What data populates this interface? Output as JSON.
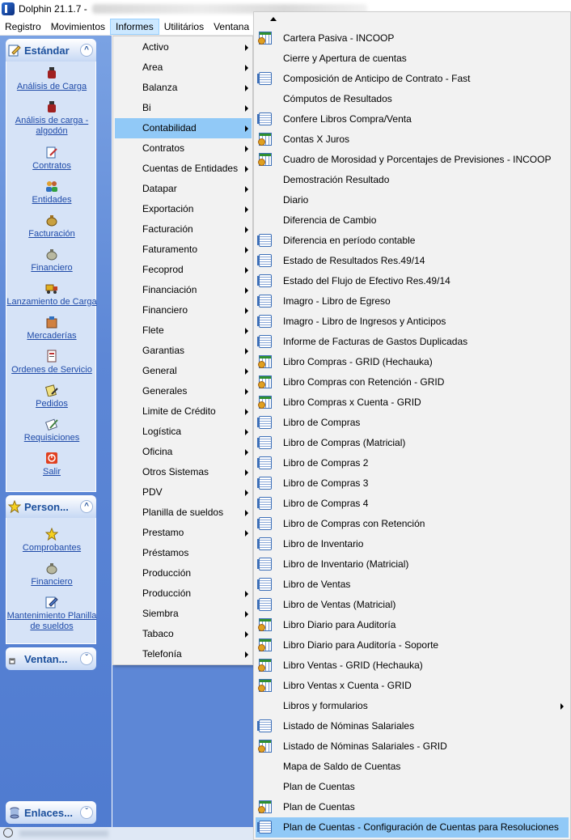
{
  "window": {
    "app_title": "Dolphin 21.1.7 -"
  },
  "menubar": [
    "Registro",
    "Movimientos",
    "Informes",
    "Utilitários",
    "Ventana"
  ],
  "left_panel": {
    "groups": [
      {
        "title": "Estándar",
        "items": [
          "Análisis de Carga",
          "Análisis de carga - algodón",
          "Contratos",
          "Entidades",
          "Facturación",
          "Financiero",
          "Lanzamiento de Carga",
          "Mercaderías",
          "Ordenes de Servicio",
          "Pedidos",
          "Requisiciones",
          "Salir"
        ]
      },
      {
        "title": "Person...",
        "items": [
          "Comprobantes",
          "Financiero",
          "Mantenimiento Planilla de sueldos"
        ]
      },
      {
        "title": "Ventan..."
      },
      {
        "title": "Enlaces..."
      }
    ]
  },
  "informes_menu": [
    "Activo",
    "Area",
    "Balanza",
    "Bi",
    "Contabilidad",
    "Contratos",
    "Cuentas de Entidades",
    "Datapar",
    "Exportación",
    "Facturación",
    "Faturamento",
    "Fecoprod",
    "Financiación",
    "Financiero",
    "Flete",
    "Garantias",
    "General",
    "Generales",
    "Limite de Crédito",
    "Logística",
    "Oficina",
    "Otros Sistemas",
    "PDV",
    "Planilla de sueldos",
    "Prestamo",
    "Préstamos",
    "Producción",
    "Producción",
    "Siembra",
    "Tabaco",
    "Telefonía"
  ],
  "contabilidad_menu": [
    {
      "label": "Cartera Pasiva - INCOOP",
      "icon": "grid-report-icon"
    },
    {
      "label": "Cierre y Apertura de cuentas",
      "icon": ""
    },
    {
      "label": "Composición de Anticipo de Contrato - Fast",
      "icon": "document-report-icon"
    },
    {
      "label": "Cómputos de Resultados",
      "icon": ""
    },
    {
      "label": "Confere Libros Compra/Venta",
      "icon": "document-report-icon"
    },
    {
      "label": "Contas X Juros",
      "icon": "grid-report-icon"
    },
    {
      "label": "Cuadro de Morosidad y Porcentajes de Previsiones - INCOOP",
      "icon": "grid-report-icon"
    },
    {
      "label": "Demostración Resultado",
      "icon": ""
    },
    {
      "label": "Diario",
      "icon": ""
    },
    {
      "label": "Diferencia de Cambio",
      "icon": ""
    },
    {
      "label": "Diferencia en período contable",
      "icon": "document-report-icon"
    },
    {
      "label": "Estado de Resultados Res.49/14",
      "icon": "document-report-icon"
    },
    {
      "label": "Estado del Flujo de Efectivo Res.49/14",
      "icon": "document-report-icon"
    },
    {
      "label": "Imagro - Libro de Egreso",
      "icon": "document-report-icon"
    },
    {
      "label": "Imagro - Libro de Ingresos y Anticipos",
      "icon": "document-report-icon"
    },
    {
      "label": "Informe de Facturas de Gastos Duplicadas",
      "icon": "document-report-icon"
    },
    {
      "label": "Libro Compras - GRID (Hechauka)",
      "icon": "grid-report-icon"
    },
    {
      "label": "Libro Compras con Retención - GRID",
      "icon": "grid-report-icon"
    },
    {
      "label": "Libro Compras x Cuenta - GRID",
      "icon": "grid-report-icon"
    },
    {
      "label": "Libro de Compras",
      "icon": "document-report-icon"
    },
    {
      "label": "Libro de Compras (Matricial)",
      "icon": "document-report-icon"
    },
    {
      "label": "Libro de Compras 2",
      "icon": "document-report-icon"
    },
    {
      "label": "Libro de Compras 3",
      "icon": "document-report-icon"
    },
    {
      "label": "Libro de Compras 4",
      "icon": "document-report-icon"
    },
    {
      "label": "Libro de Compras con Retención",
      "icon": "document-report-icon"
    },
    {
      "label": "Libro de Inventario",
      "icon": "document-report-icon"
    },
    {
      "label": "Libro de Inventario (Matricial)",
      "icon": "document-report-icon"
    },
    {
      "label": "Libro de Ventas",
      "icon": "document-report-icon"
    },
    {
      "label": "Libro de Ventas (Matricial)",
      "icon": "document-report-icon"
    },
    {
      "label": "Libro Diario para Auditoría",
      "icon": "grid-report-icon"
    },
    {
      "label": "Libro Diario para Auditoría - Soporte",
      "icon": "grid-report-icon"
    },
    {
      "label": "Libro Ventas - GRID (Hechauka)",
      "icon": "grid-report-icon"
    },
    {
      "label": "Libro Ventas x Cuenta - GRID",
      "icon": "grid-report-icon"
    },
    {
      "label": "Libros y formularios",
      "icon": ""
    },
    {
      "label": "Listado de Nóminas Salariales",
      "icon": "document-report-icon"
    },
    {
      "label": "Listado de Nóminas Salariales - GRID",
      "icon": "grid-report-icon"
    },
    {
      "label": "Mapa de Saldo de Cuentas",
      "icon": ""
    },
    {
      "label": "Plan de Cuentas",
      "icon": ""
    },
    {
      "label": "Plan de Cuentas",
      "icon": "grid-report-icon"
    },
    {
      "label": "Plan de Cuentas - Configuración de Cuentas para Resoluciones",
      "icon": "document-report-icon"
    }
  ],
  "colors": {
    "highlight": "#91c9f7",
    "panel_blue": "#5d87d6",
    "link_blue": "#1e4aa8"
  }
}
